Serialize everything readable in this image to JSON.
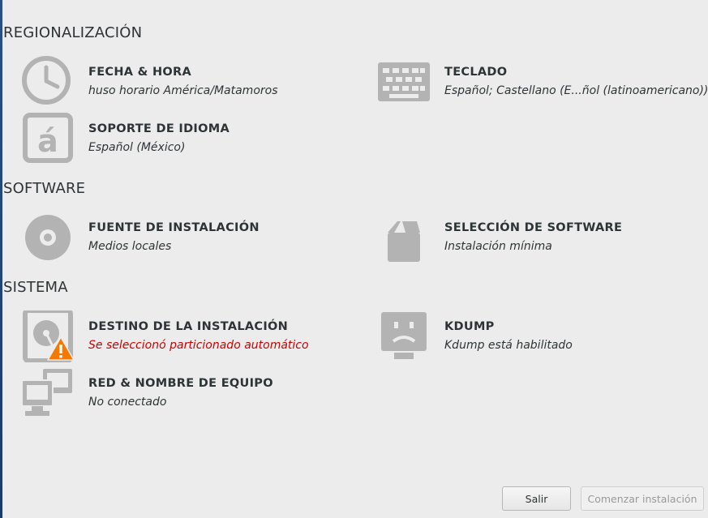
{
  "sections": {
    "regionalization": "REGIONALIZACIÓN",
    "software": "SOFTWARE",
    "system": "SISTEMA"
  },
  "spokes": {
    "date_time": {
      "title": "FECHA & HORA",
      "status": "huso horario América/Matamoros",
      "icon": "clock-icon"
    },
    "keyboard": {
      "title": "TECLADO",
      "status": "Español; Castellano (E...ñol (latinoamericano))",
      "icon": "keyboard-icon"
    },
    "language": {
      "title": "SOPORTE DE IDIOMA",
      "status": "Español (México)",
      "icon": "language-icon"
    },
    "source": {
      "title": "FUENTE DE INSTALACIÓN",
      "status": "Medios locales",
      "icon": "disc-icon"
    },
    "software": {
      "title": "SELECCIÓN DE SOFTWARE",
      "status": "Instalación mínima",
      "icon": "package-icon"
    },
    "destination": {
      "title": "DESTINO DE LA INSTALACIÓN",
      "status": "Se seleccionó particionado automático",
      "icon": "hard-drive-icon"
    },
    "kdump": {
      "title": "KDUMP",
      "status": "Kdump está habilitado",
      "icon": "kdump-icon"
    },
    "network": {
      "title": "RED & NOMBRE DE EQUIPO",
      "status": "No conectado",
      "icon": "network-icon"
    }
  },
  "buttons": {
    "quit": "Salir",
    "begin": "Comenzar instalación"
  },
  "colors": {
    "background": "#ececec",
    "icon_gray": "#b3b3b3",
    "warning_text": "#cc0000",
    "warning_badge": "#f57900"
  }
}
